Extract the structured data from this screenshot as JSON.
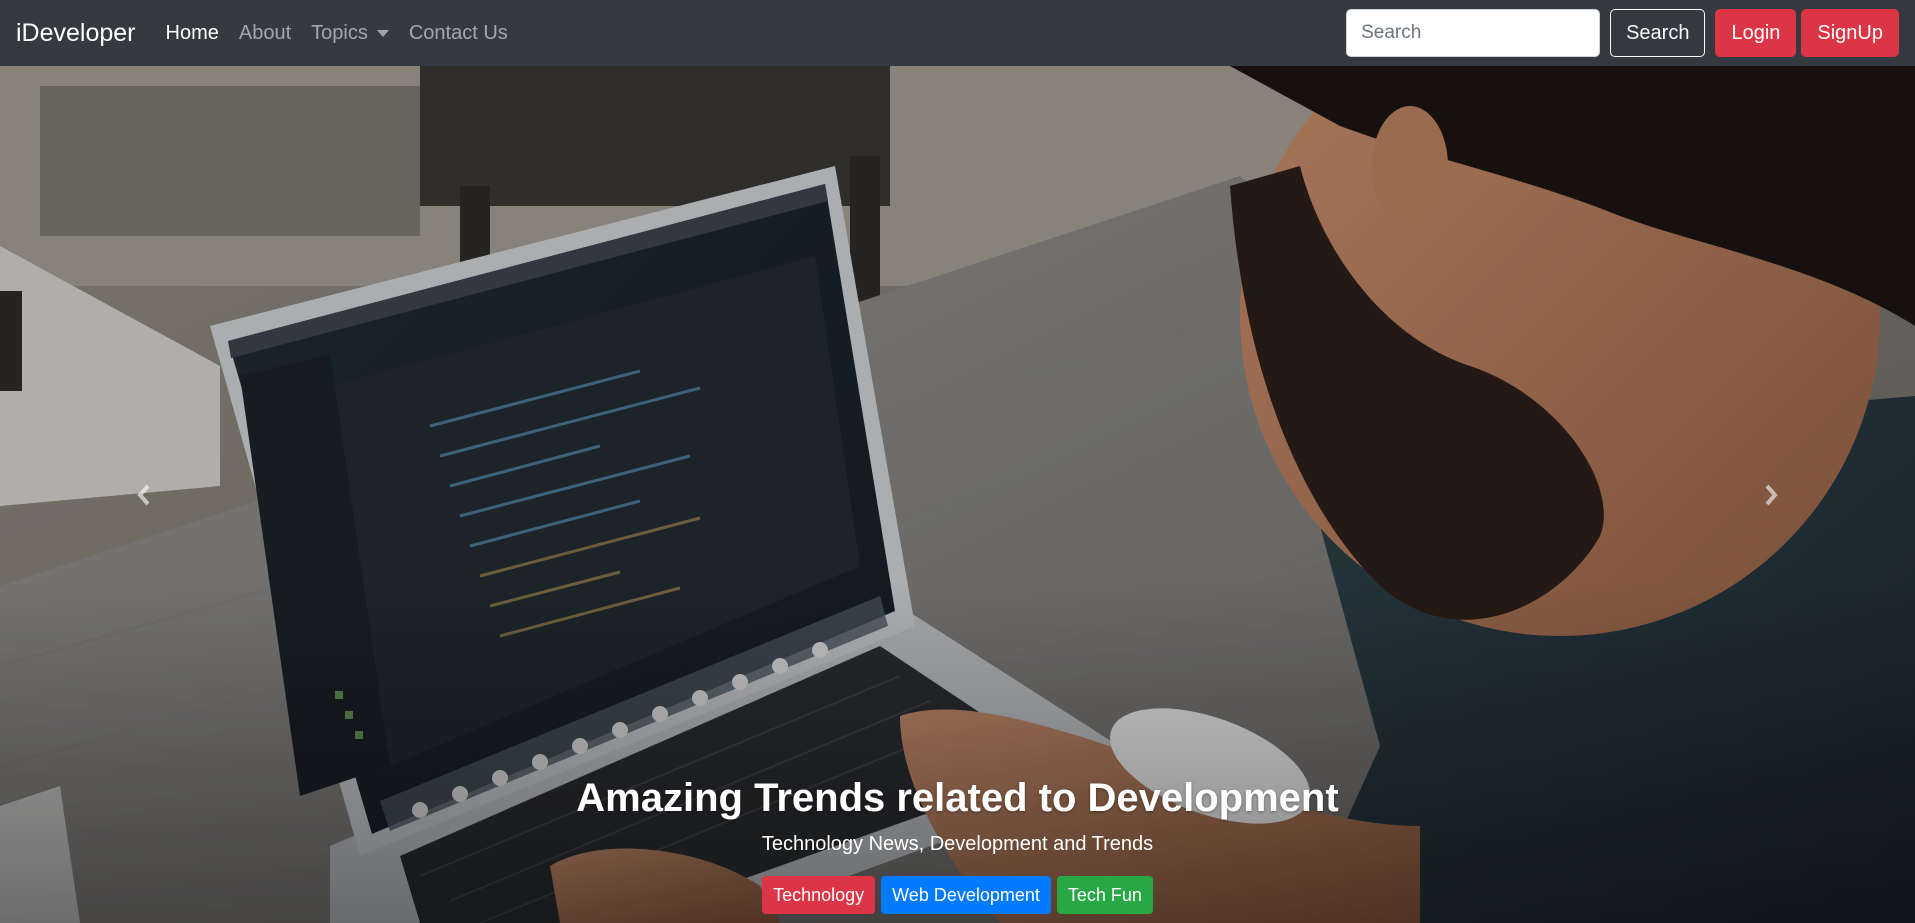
{
  "navbar": {
    "brand": "iDeveloper",
    "links": [
      {
        "label": "Home",
        "active": true
      },
      {
        "label": "About",
        "active": false
      },
      {
        "label": "Topics",
        "active": false,
        "dropdown": true
      },
      {
        "label": "Contact Us",
        "active": false
      }
    ],
    "search": {
      "placeholder": "Search",
      "value": ""
    },
    "search_button": "Search",
    "login_button": "Login",
    "signup_button": "SignUp"
  },
  "hero": {
    "title": "Amazing Trends related to Development",
    "subtitle": "Technology News, Development and Trends",
    "tags": [
      {
        "label": "Technology",
        "color": "#dc3545"
      },
      {
        "label": "Web Development",
        "color": "#007bff"
      },
      {
        "label": "Tech Fun",
        "color": "#28a745"
      }
    ],
    "prev_icon": "chevron-left-icon",
    "next_icon": "chevron-right-icon"
  },
  "colors": {
    "navbar_bg": "#343a40",
    "danger": "#dc3545",
    "primary": "#007bff",
    "success": "#28a745"
  }
}
